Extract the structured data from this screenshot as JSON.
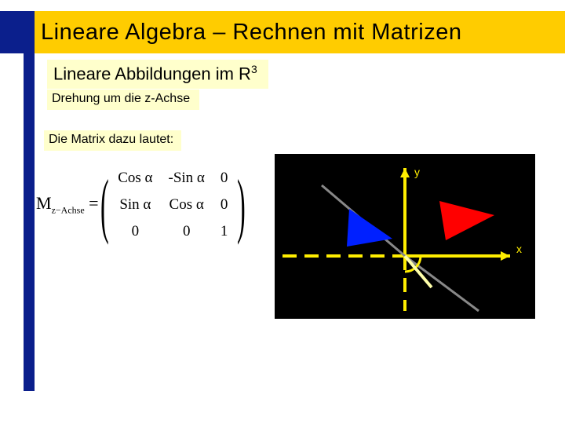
{
  "title": "Lineare Algebra – Rechnen mit Matrizen",
  "subtitle": {
    "text_prefix": "Lineare Abbildungen im R",
    "sup": "3"
  },
  "sub2": "Drehung um die z-Achse",
  "sub3": "Die Matrix dazu lautet:",
  "matrix": {
    "label_main": "M",
    "label_sub": "z−Achse",
    "equals": "=",
    "rows": [
      [
        "Cos α",
        "-Sin α",
        "0"
      ],
      [
        "Sin α",
        "Cos α",
        "0"
      ],
      [
        "0",
        "0",
        "1"
      ]
    ]
  },
  "diagram": {
    "x_label": "x",
    "y_label": "y"
  }
}
